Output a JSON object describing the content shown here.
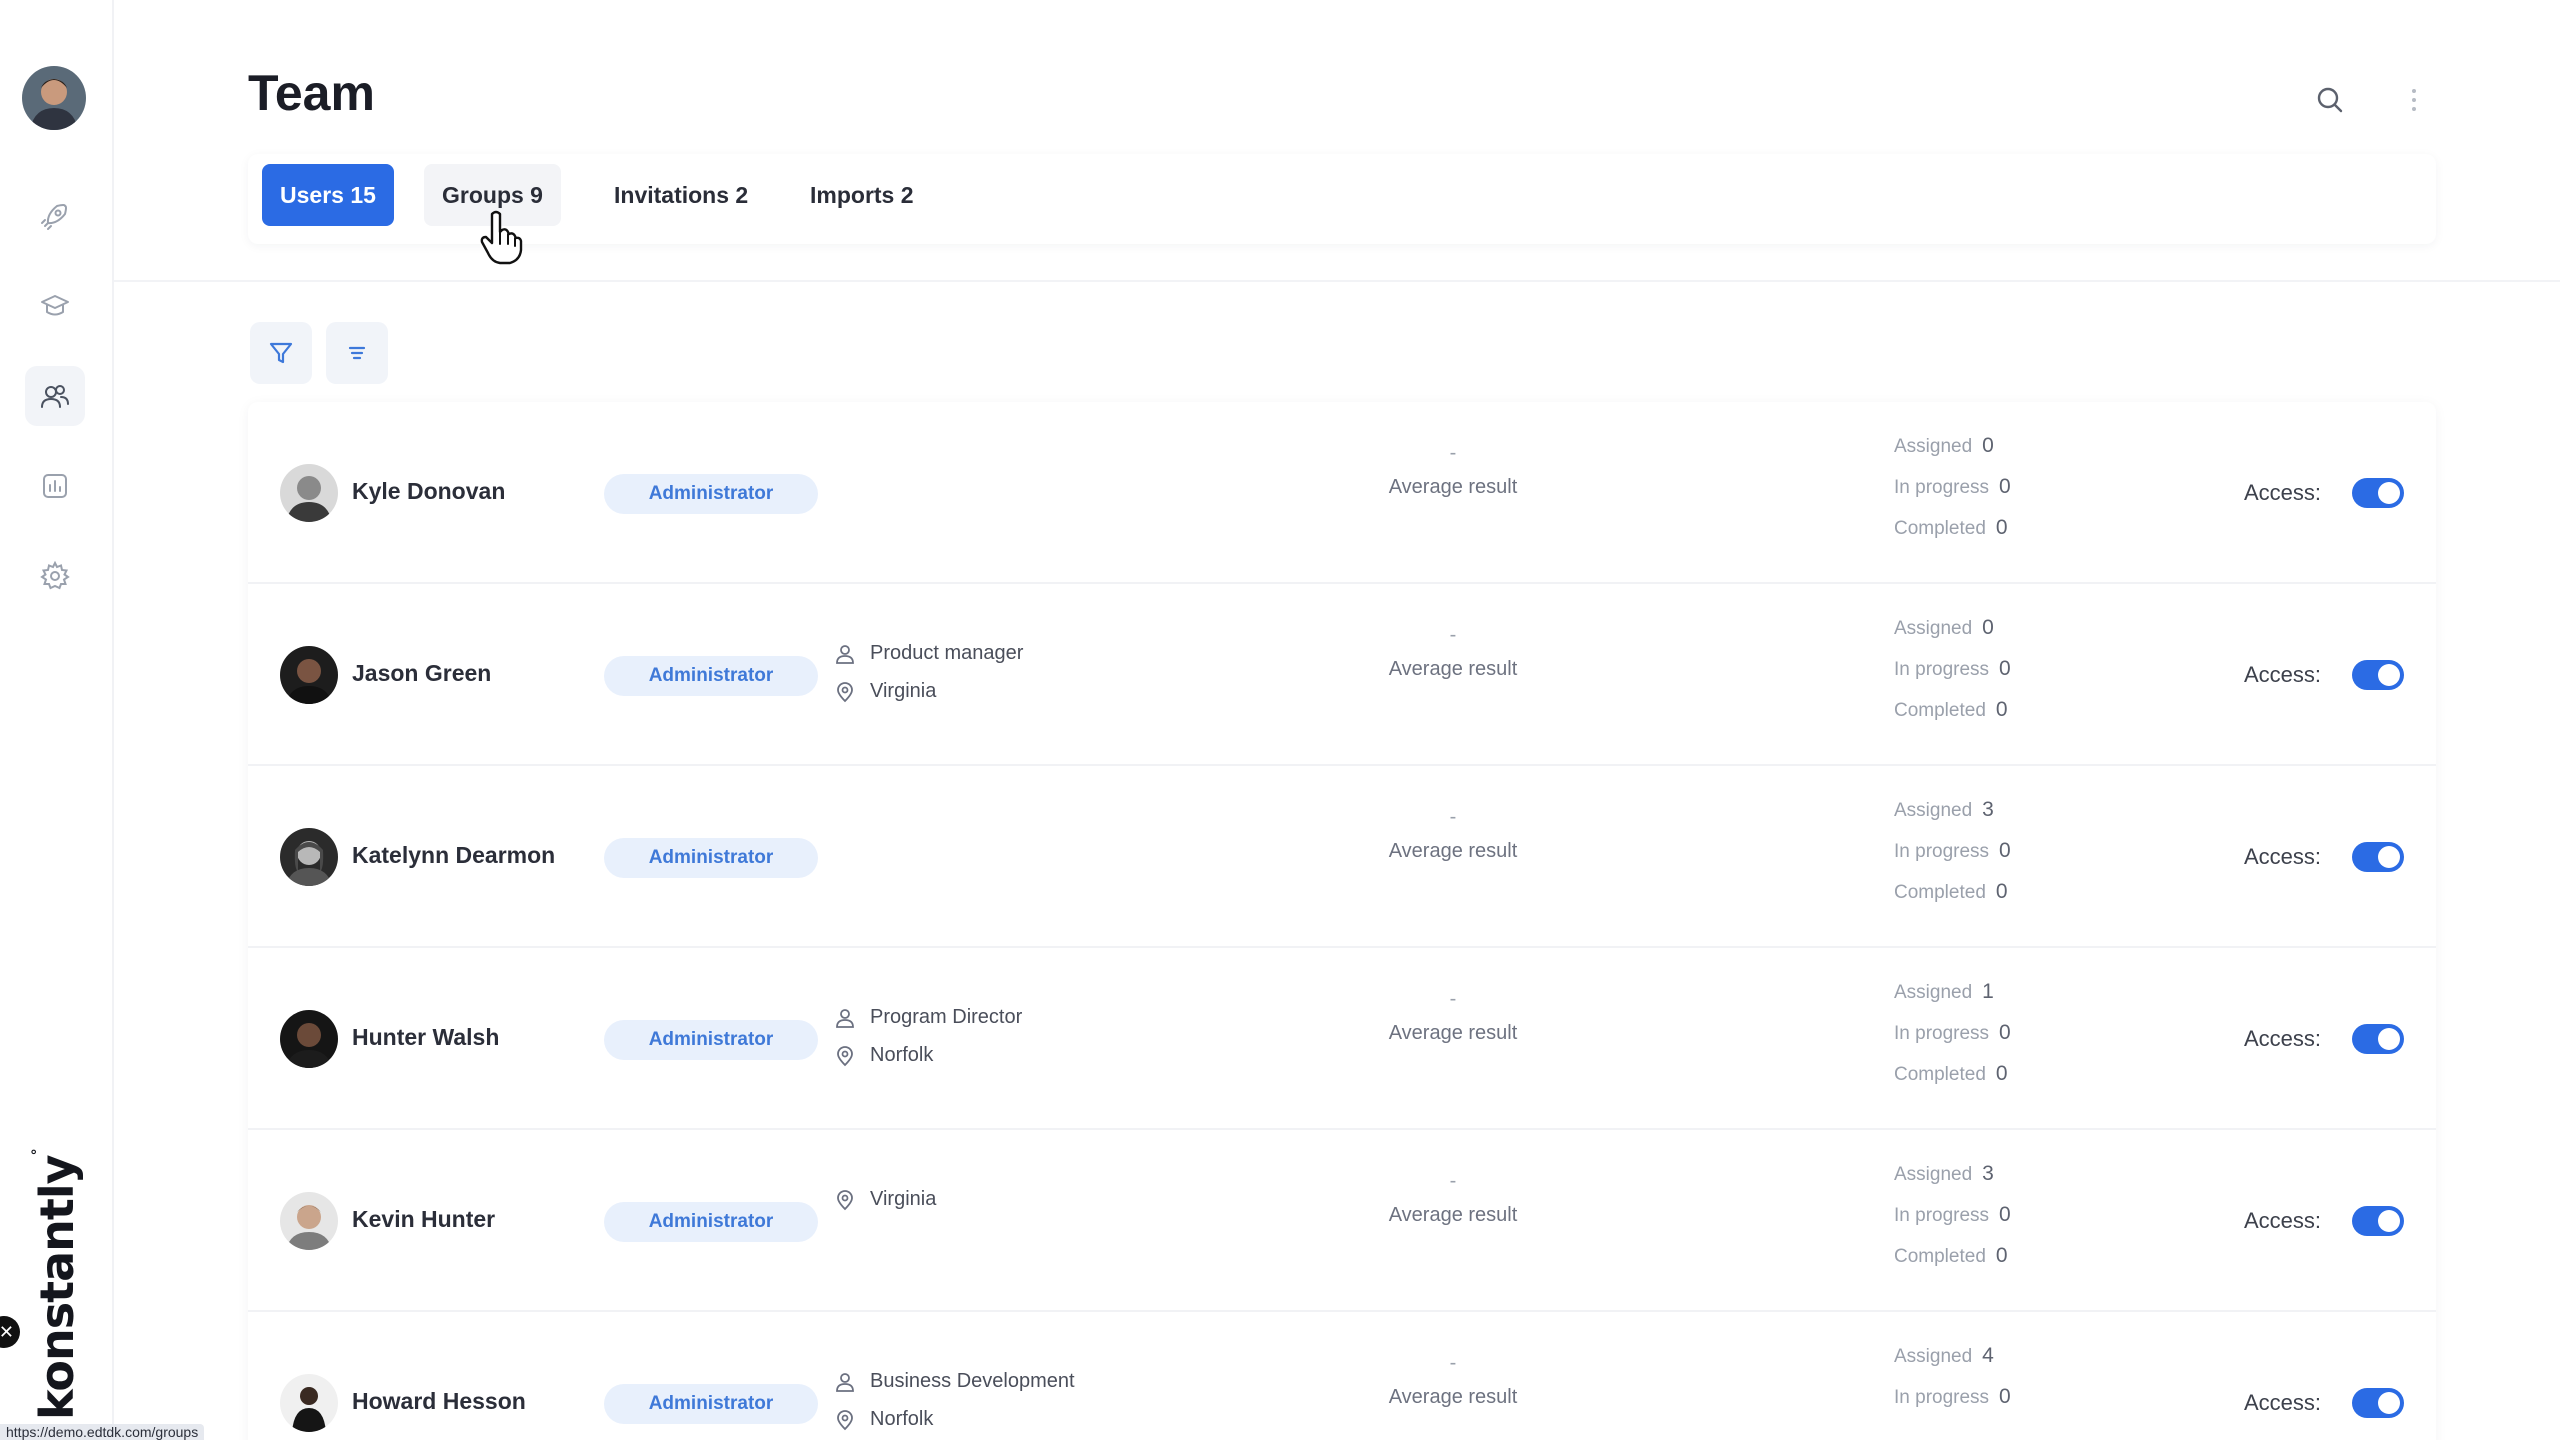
{
  "page": {
    "title": "Team"
  },
  "sidebar": {
    "brand": "konstantly",
    "brand_mark": "°",
    "items": [
      {
        "name": "rocket-icon"
      },
      {
        "name": "graduation-cap-icon"
      },
      {
        "name": "team-icon",
        "active": true
      },
      {
        "name": "chart-icon"
      },
      {
        "name": "gear-icon"
      }
    ]
  },
  "tabs": [
    {
      "label": "Users 15",
      "active": true
    },
    {
      "label": "Groups 9",
      "hover": true
    },
    {
      "label": "Invitations 2"
    },
    {
      "label": "Imports 2"
    }
  ],
  "status_url": "https://demo.edtdk.com/groups",
  "list": {
    "avg_label": "Average result",
    "avg_value": "-",
    "stat_labels": {
      "assigned": "Assigned",
      "in_progress": "In progress",
      "completed": "Completed"
    },
    "access_label": "Access:",
    "users": [
      {
        "name": "Kyle Donovan",
        "role": "Administrator",
        "position": "",
        "location": "",
        "assigned": "0",
        "in_progress": "0",
        "completed": "0",
        "access": true
      },
      {
        "name": "Jason Green",
        "role": "Administrator",
        "position": "Product manager",
        "location": "Virginia",
        "assigned": "0",
        "in_progress": "0",
        "completed": "0",
        "access": true
      },
      {
        "name": "Katelynn Dearmon",
        "role": "Administrator",
        "position": "",
        "location": "",
        "assigned": "3",
        "in_progress": "0",
        "completed": "0",
        "access": true
      },
      {
        "name": "Hunter Walsh",
        "role": "Administrator",
        "position": "Program Director",
        "location": "Norfolk",
        "assigned": "1",
        "in_progress": "0",
        "completed": "0",
        "access": true
      },
      {
        "name": "Kevin Hunter",
        "role": "Administrator",
        "position": "",
        "location": "Virginia",
        "assigned": "3",
        "in_progress": "0",
        "completed": "0",
        "access": true
      },
      {
        "name": "Howard Hesson",
        "role": "Administrator",
        "position": "Business Development",
        "location": "Norfolk",
        "assigned": "4",
        "in_progress": "0",
        "completed": "",
        "access": true
      }
    ]
  }
}
